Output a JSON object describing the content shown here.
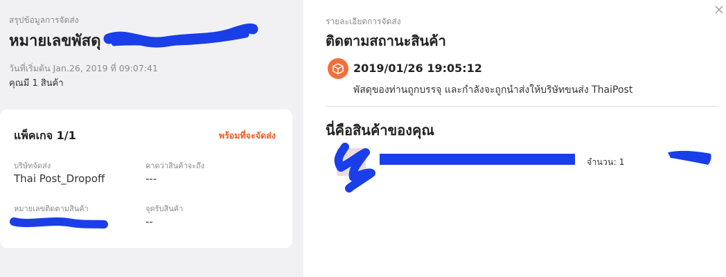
{
  "summary": {
    "caption": "สรุปข้อมูลการจัดส่ง",
    "title": "หมายเลขพัสดุ",
    "start_date": "วันที่เริ่มต้น Jan.26, 2019 ที่ 09:07:41",
    "item_count": "คุณมี 1 สินค้า"
  },
  "package": {
    "label": "แพ็คเกจ 1/1",
    "status": "พร้อมที่จะจัดส่ง",
    "carrier_label": "บริษัทจัดส่ง",
    "carrier_value": "Thai Post_Dropoff",
    "eta_label": "คาดว่าสินค้าจะถึง",
    "eta_value": "---",
    "tracking_label": "หมายเลขติดตามสินค้า",
    "pickup_label": "จุดรับสินค้า",
    "pickup_value": "--"
  },
  "details": {
    "caption": "รายละเอียดการจัดส่ง",
    "title": "ติดตามสถานะสินค้า",
    "event_time": "2019/01/26 19:05:12",
    "event_desc": "พัสดุของท่านถูกบรรจุ และกำลังจะถูกนำส่งให้บริษัทขนส่ง ThaiPost",
    "items_title": "นี่คือสินค้าของคุณ",
    "quantity": "จำนวน: 1"
  },
  "colors": {
    "accent": "#ee5a24",
    "status_icon": "#f36f3a",
    "redaction": "#1a3ee8"
  },
  "icons": {
    "close": "close-icon",
    "status": "package-icon"
  }
}
